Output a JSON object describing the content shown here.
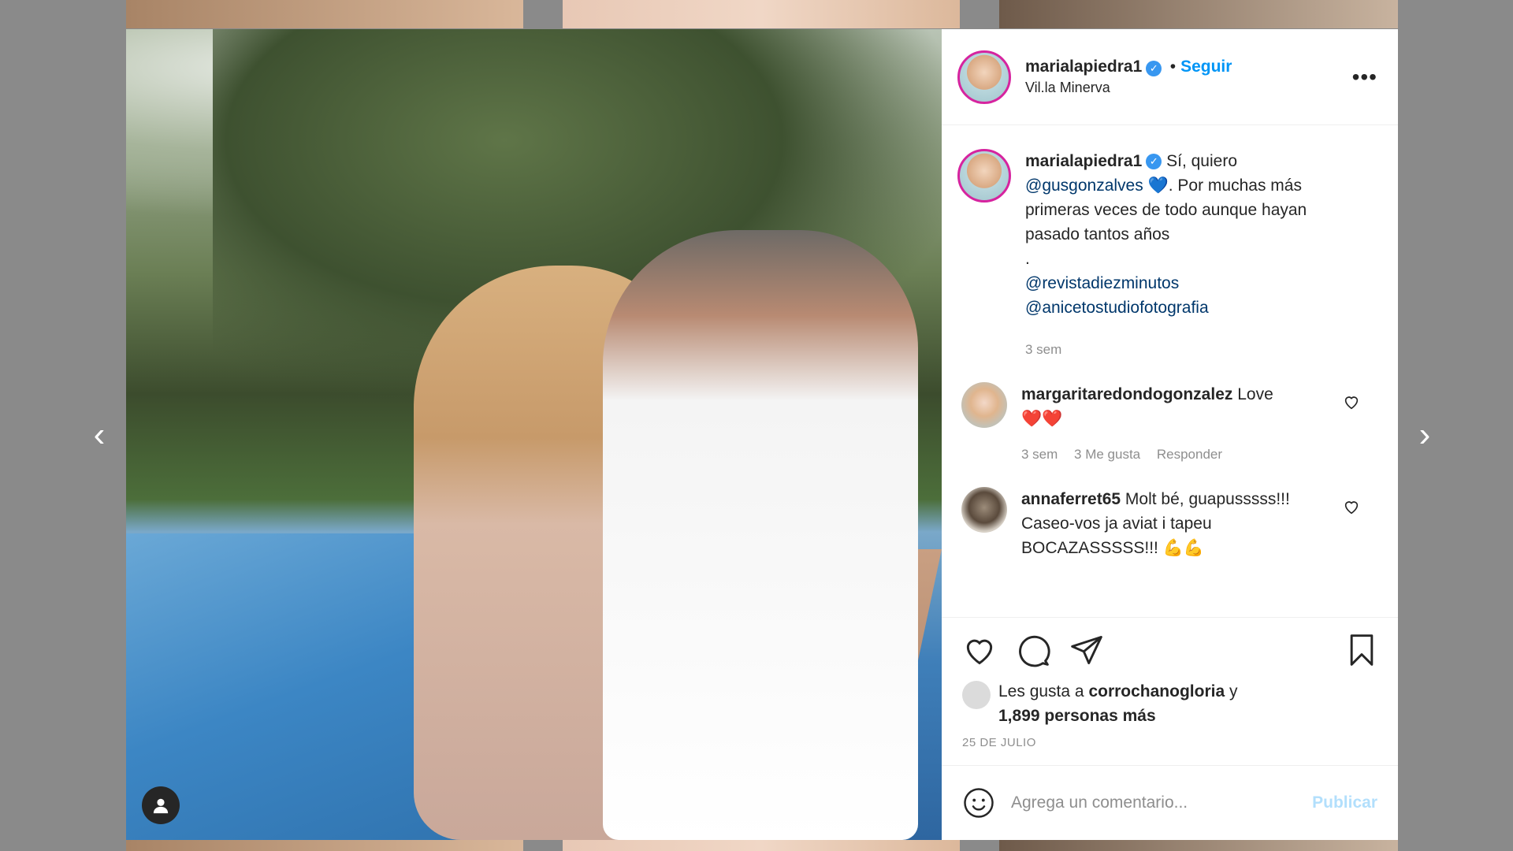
{
  "header": {
    "username": "marialapiedra1",
    "separator": "•",
    "follow_label": "Seguir",
    "location": "Vil.la Minerva",
    "more_label": "•••"
  },
  "caption": {
    "username": "marialapiedra1",
    "text_1": "Sí, quiero",
    "mention_1": "@gusgonzalves",
    "emoji_1": "💙",
    "text_2": ". Por muchas más primeras veces de todo aunque hayan pasado tantos años",
    "dot": ".",
    "mention_2": "@revistadiezminutos",
    "mention_3": "@anicetostudiofotografia",
    "time": "3 sem"
  },
  "comments": [
    {
      "username": "margaritaredondogonzalez",
      "text": "Love",
      "emoji": "❤️❤️",
      "time": "3 sem",
      "likes": "3 Me gusta",
      "reply": "Responder"
    },
    {
      "username": "annaferret65",
      "text": "Molt bé, guapusssss!!! Caseo-vos ja aviat i tapeu BOCAZASSSSS!!!",
      "emoji": "💪💪"
    }
  ],
  "likes": {
    "prefix": "Les gusta a",
    "user": "corrochanogloria",
    "conj": "y",
    "others": "1,899 personas más"
  },
  "date": "25 DE JULIO",
  "composer": {
    "placeholder": "Agrega un comentario...",
    "post_label": "Publicar"
  },
  "nav": {
    "prev": "‹",
    "next": "›"
  },
  "icons": {
    "verified": "✓",
    "like": "heart-icon",
    "comment": "comment-icon",
    "share": "paper-plane-icon",
    "save": "bookmark-icon",
    "emoji": "smiley-icon",
    "user_tag": "user-icon"
  },
  "colors": {
    "accent": "#0095f6",
    "verified": "#3897f0",
    "muted": "#8e8e8e",
    "post_disabled": "#b2dffc"
  }
}
